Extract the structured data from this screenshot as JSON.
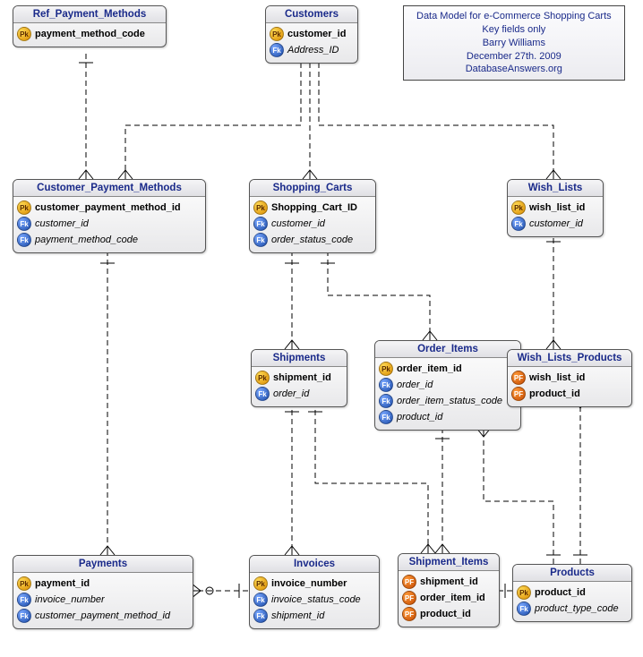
{
  "info": {
    "l1": "Data Model for e-Commerce Shopping Carts",
    "l2": "Key fields only",
    "l3": "Barry Williams",
    "l4": "December 27th. 2009",
    "l5": "DatabaseAnswers.org"
  },
  "key_labels": {
    "pk": "Pk",
    "fk": "Fk",
    "pf": "PF"
  },
  "entities": {
    "ref_payment_methods": {
      "title": "Ref_Payment_Methods",
      "fields": [
        {
          "k": "pk",
          "name": "payment_method_code",
          "bold": true
        }
      ]
    },
    "customers": {
      "title": "Customers",
      "fields": [
        {
          "k": "pk",
          "name": "customer_id",
          "bold": true
        },
        {
          "k": "fk",
          "name": "Address_ID",
          "italic": true
        }
      ]
    },
    "customer_payment_methods": {
      "title": "Customer_Payment_Methods",
      "fields": [
        {
          "k": "pk",
          "name": "customer_payment_method_id",
          "bold": true
        },
        {
          "k": "fk",
          "name": "customer_id",
          "italic": true
        },
        {
          "k": "fk",
          "name": "payment_method_code",
          "italic": true
        }
      ]
    },
    "shopping_carts": {
      "title": "Shopping_Carts",
      "fields": [
        {
          "k": "pk",
          "name": "Shopping_Cart_ID",
          "bold": true
        },
        {
          "k": "fk",
          "name": "customer_id",
          "italic": true
        },
        {
          "k": "fk",
          "name": "order_status_code",
          "italic": true
        }
      ]
    },
    "wish_lists": {
      "title": "Wish_Lists",
      "fields": [
        {
          "k": "pk",
          "name": "wish_list_id",
          "bold": true
        },
        {
          "k": "fk",
          "name": "customer_id",
          "italic": true
        }
      ]
    },
    "shipments": {
      "title": "Shipments",
      "fields": [
        {
          "k": "pk",
          "name": "shipment_id",
          "bold": true
        },
        {
          "k": "fk",
          "name": "order_id",
          "italic": true
        }
      ]
    },
    "order_items": {
      "title": "Order_Items",
      "fields": [
        {
          "k": "pk",
          "name": "order_item_id",
          "bold": true
        },
        {
          "k": "fk",
          "name": "order_id",
          "italic": true
        },
        {
          "k": "fk",
          "name": "order_item_status_code",
          "italic": true
        },
        {
          "k": "fk",
          "name": "product_id",
          "italic": true
        }
      ]
    },
    "wish_lists_products": {
      "title": "Wish_Lists_Products",
      "fields": [
        {
          "k": "pf",
          "name": "wish_list_id",
          "bold": true
        },
        {
          "k": "pf",
          "name": "product_id",
          "bold": true
        }
      ]
    },
    "payments": {
      "title": "Payments",
      "fields": [
        {
          "k": "pk",
          "name": "payment_id",
          "bold": true
        },
        {
          "k": "fk",
          "name": "invoice_number",
          "italic": true
        },
        {
          "k": "fk",
          "name": "customer_payment_method_id",
          "italic": true
        }
      ]
    },
    "invoices": {
      "title": "Invoices",
      "fields": [
        {
          "k": "pk",
          "name": "invoice_number",
          "bold": true
        },
        {
          "k": "fk",
          "name": "invoice_status_code",
          "italic": true
        },
        {
          "k": "fk",
          "name": "shipment_id",
          "italic": true
        }
      ]
    },
    "shipment_items": {
      "title": "Shipment_Items",
      "fields": [
        {
          "k": "pf",
          "name": "shipment_id",
          "bold": true
        },
        {
          "k": "pf",
          "name": "order_item_id",
          "bold": true
        },
        {
          "k": "pf",
          "name": "product_id",
          "bold": true
        }
      ]
    },
    "products": {
      "title": "Products",
      "fields": [
        {
          "k": "pk",
          "name": "product_id",
          "bold": true
        },
        {
          "k": "fk",
          "name": "product_type_code",
          "italic": true
        }
      ]
    }
  }
}
